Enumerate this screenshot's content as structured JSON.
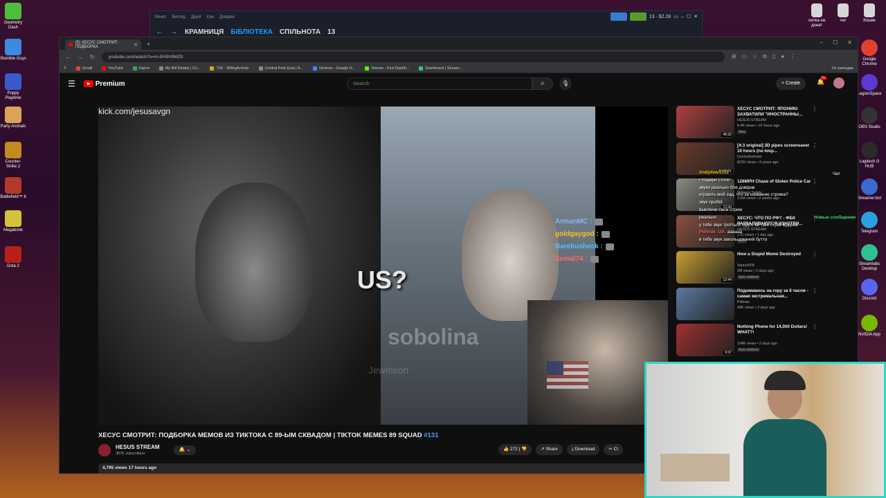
{
  "desktop": {
    "left_icons": [
      {
        "label": "Geometry Dash",
        "color": "#4bbf3b"
      },
      {
        "label": "Stumble Guys",
        "color": "#3d8ae0"
      },
      {
        "label": "Poppy Playtime",
        "color": "#3a5acc"
      },
      {
        "label": "Party Animals",
        "color": "#d9a455"
      },
      {
        "label": "Counter-Strike 2",
        "color": "#c38a20"
      },
      {
        "label": "Battlefield™ 6",
        "color": "#b23a2a"
      },
      {
        "label": "Megabonk",
        "color": "#d6c23a"
      },
      {
        "label": "Dota 2",
        "color": "#b8201a"
      }
    ],
    "right_icons_top": [
      {
        "label": "силка на донат",
        "color": "#d6d6d6"
      },
      {
        "label": "чат",
        "color": "#d6d6d6"
      },
      {
        "label": "Кошик",
        "color": "#d6d6d6"
      }
    ],
    "right_icons_side": [
      {
        "label": "Google Chrome",
        "color": "#e04030"
      },
      {
        "label": "LegionSpace",
        "color": "#5a3ad0"
      },
      {
        "label": "OBS Studio",
        "color": "#333333"
      },
      {
        "label": "Logitech G HUB",
        "color": "#2a2a2a"
      },
      {
        "label": "Streamer.bot",
        "color": "#3a6ad0"
      },
      {
        "label": "Telegram",
        "color": "#2aa0e0"
      },
      {
        "label": "Streamlabs Desktop",
        "color": "#30c090"
      },
      {
        "label": "Discord",
        "color": "#5865f2"
      },
      {
        "label": "NVIDIA App",
        "color": "#76b900"
      }
    ]
  },
  "steam": {
    "menu": [
      "Steam",
      "Вигляд",
      "Друзі",
      "Ігри",
      "Довідка"
    ],
    "nav": [
      "КРАМНИЦЯ",
      "БІБЛІОТЕКА",
      "СПІЛЬНОТА",
      "13"
    ],
    "active_nav": "БІБЛІОТЕКА",
    "wallet": "13 - $2.28"
  },
  "chrome": {
    "tab_title": "(5) ХЕСУС СМОТРИТ: ПОДБОРКА",
    "url": "youtube.com/watch?v=m-EH9V9MZ0",
    "bookmarks": [
      {
        "label": "Gmail",
        "color": "#ea4335"
      },
      {
        "label": "YouTube",
        "color": "#ff0000"
      },
      {
        "label": "Карти",
        "color": "#34a853"
      },
      {
        "label": "My Bill Details | Co...",
        "color": "#888888"
      },
      {
        "label": "T2K - BillingActivity",
        "color": "#e0a020"
      },
      {
        "label": "Central Park East | A...",
        "color": "#888888"
      },
      {
        "label": "Devices - Google H...",
        "color": "#4285f4"
      },
      {
        "label": "Stream - Kick Dashb...",
        "color": "#53fc18"
      },
      {
        "label": "Dashboard | Stream...",
        "color": "#30c090"
      }
    ],
    "bookmarks_right": "Усі закладки"
  },
  "youtube": {
    "logo": "Premium",
    "search_placeholder": "Search",
    "create_label": "+ Create",
    "notifications": "9+",
    "player": {
      "kick_url": "kick.com/jesusavgn",
      "caption": "US?",
      "watermark": "sobolina",
      "watermark2": "Jewinson",
      "overlay_chat": [
        {
          "user": "ArmanMC :",
          "color": "#8ab4f8"
        },
        {
          "user": "goldgaygod :",
          "color": "#f5c518"
        },
        {
          "user": "Barebusheck :",
          "color": "#4fc3f7"
        },
        {
          "user": "Semal74 :",
          "color": "#ff6b6b"
        }
      ]
    },
    "video": {
      "title": "ХЕСУС СМОТРИТ: ПОДБОРКА МЕМОВ ИЗ ТИКТОКА С 89-ЫМ СКВАДОМ | TIKTOK MEMES 89 SQUAD",
      "hashtag": "#131",
      "channel": "HESUS STREAM",
      "subs": "387K subscribers",
      "likes": "272",
      "share": "Share",
      "download": "Download",
      "clip": "Cl",
      "meta": "4,795 views  17 hours ago"
    },
    "recommended": [
      {
        "title": "ХЕСУС СМОТРИТ: ЯПОНИЮ ЗАХВАТИЛИ \"ИНОСТРАННЫ...",
        "channel": "HESUS STREAM",
        "meta": "8.4K views • 16 hours ago",
        "badge": "New",
        "duration": "46:32",
        "color": "#b04040"
      },
      {
        "title": "[4:3 original] 3D pipes screensaver 10 hours (no loop...",
        "channel": "DoctorDothraki",
        "meta": "822K views • 9 years ago",
        "badge": "",
        "duration": "10:00:01",
        "color": "#6a3a2a"
      },
      {
        "title": "126MPH Chase of Stolen Police Car",
        "channel": "Midwest Safety",
        "meta": "3.5M views • 2 weeks ago",
        "badge": "",
        "duration": "17:33",
        "color": "#8a8a80"
      },
      {
        "title": "ХЕСУС: ЧТО ПО РФ? - ФБК РАЗВАЛИВАЮТСЯ ИЗНУТРИ...",
        "channel": "HESUS STREAM",
        "meta": "17K views • 1 day ago",
        "badge": "New",
        "duration": "",
        "color": "#8a5040"
      },
      {
        "title": "How a Stupid Meme Destroyed",
        "channel": "VanushFN",
        "meta": "2M views • 2 days ago",
        "badge": "Auto-dubbed",
        "duration": "12:44",
        "color": "#c8a030"
      },
      {
        "title": "Поднимаюсь на гору за 6 часов - самая экстремальная...",
        "channel": "Pidoras",
        "meta": "40K views • 3 days ago",
        "badge": "",
        "duration": "",
        "color": "#5a7aa0"
      },
      {
        "title": "Nothing Phone for 14,000 Dollars! WHAT?!",
        "channel": "",
        "meta": "104K views • 2 days ago",
        "badge": "Auto-dubbed",
        "duration": "9:37",
        "color": "#a03030"
      }
    ]
  },
  "stream_chat": {
    "label": "Чат",
    "new_messages": "Новые сообщения",
    "lines": [
      {
        "user": "Andyliwe1312",
        "text": "",
        "color": "#f5c518"
      },
      {
        "user": "",
        "text": "• подари столи",
        "color": "#ffffff"
      },
      {
        "user": "",
        "text": "звуки реально бля довірив",
        "color": "#ffffff"
      },
      {
        "user": "",
        "text": "играють мой зад, что за название стрима?",
        "color": "#ffffff"
      },
      {
        "user": "",
        "text": "звук пробій",
        "color": "#ffffff"
      },
      {
        "user": "",
        "text": "выключи свой стрим",
        "color": "#ffffff"
      },
      {
        "user": "",
        "text": "реально",
        "color": "#ffffff"
      },
      {
        "user": "",
        "text": "у тебе звук троїться будто ви свій стрім відкрив",
        "color": "#ffffff"
      },
      {
        "user": "Pidoras_UA:",
        "text": "аааааа",
        "color": "#ff6b6b"
      },
      {
        "user": "",
        "text": "в тебе звук закольцований бутто",
        "color": "#ffffff"
      }
    ]
  }
}
